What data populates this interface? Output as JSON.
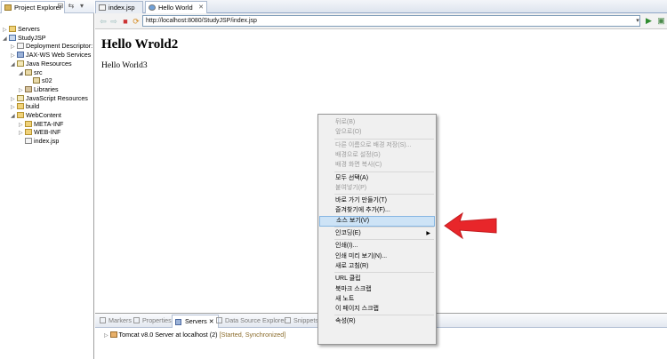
{
  "left_panel": {
    "tab_label": "Project Explorer",
    "tree": [
      {
        "label": "Servers",
        "level": 0,
        "icon": "folder-icon"
      },
      {
        "label": "StudyJSP",
        "level": 0,
        "icon": "project-icon"
      },
      {
        "label": "Deployment Descriptor:",
        "level": 1,
        "icon": "descriptor-icon"
      },
      {
        "label": "JAX-WS Web Services",
        "level": 1,
        "icon": "webservice-icon"
      },
      {
        "label": "Java Resources",
        "level": 1,
        "icon": "java-resources-icon"
      },
      {
        "label": "src",
        "level": 2,
        "icon": "source-folder-icon"
      },
      {
        "label": "s02",
        "level": 3,
        "icon": "package-icon"
      },
      {
        "label": "Libraries",
        "level": 2,
        "icon": "library-icon"
      },
      {
        "label": "JavaScript Resources",
        "level": 1,
        "icon": "javascript-resources-icon"
      },
      {
        "label": "build",
        "level": 1,
        "icon": "folder-icon"
      },
      {
        "label": "WebContent",
        "level": 1,
        "icon": "folder-icon"
      },
      {
        "label": "META-INF",
        "level": 2,
        "icon": "folder-icon"
      },
      {
        "label": "WEB-INF",
        "level": 2,
        "icon": "folder-icon"
      },
      {
        "label": "index.jsp",
        "level": 2,
        "icon": "jsp-file-icon"
      }
    ]
  },
  "editor": {
    "tabs": [
      {
        "label": "index.jsp",
        "active": false
      },
      {
        "label": "Hello World",
        "active": true
      }
    ],
    "url": "http://localhost:8080/StudyJSP/index.jsp",
    "page_heading": "Hello Wrold2",
    "page_text": "Hello World3"
  },
  "bottom_panel": {
    "tabs": [
      {
        "label": "Markers",
        "active": false
      },
      {
        "label": "Properties",
        "active": false
      },
      {
        "label": "Servers",
        "active": true
      },
      {
        "label": "Data Source Explorer",
        "active": false
      },
      {
        "label": "Snippets",
        "active": false
      }
    ],
    "server_name": "Tomcat v8.0 Server at localhost",
    "server_count": "(2)",
    "server_status": "[Started, Synchronized]"
  },
  "context_menu": {
    "items": [
      {
        "label": "뒤로(B)",
        "disabled": true
      },
      {
        "label": "앞으로(O)",
        "disabled": true
      },
      {
        "sep": true
      },
      {
        "label": "다른 이름으로 배경 저장(S)...",
        "disabled": true
      },
      {
        "label": "배경으로 설정(G)",
        "disabled": true
      },
      {
        "label": "배경 화면 복사(C)",
        "disabled": true
      },
      {
        "sep": true
      },
      {
        "label": "모두 선택(A)",
        "disabled": false
      },
      {
        "label": "붙여넣기(P)",
        "disabled": true
      },
      {
        "sep": true
      },
      {
        "label": "바로 가기 만들기(T)",
        "disabled": false
      },
      {
        "label": "즐겨찾기에 추가(F)...",
        "disabled": false
      },
      {
        "label": "소스 보기(V)",
        "disabled": false,
        "highlighted": true
      },
      {
        "sep": true
      },
      {
        "label": "인코딩(E)",
        "disabled": false,
        "submenu": true
      },
      {
        "sep": true
      },
      {
        "label": "인쇄(I)...",
        "disabled": false
      },
      {
        "label": "인쇄 미리 보기(N)...",
        "disabled": false
      },
      {
        "label": "새로 고침(R)",
        "disabled": false
      },
      {
        "sep": true
      },
      {
        "label": "URL 클립",
        "disabled": false
      },
      {
        "label": "북마크 스크랩",
        "disabled": false
      },
      {
        "label": "새 노트",
        "disabled": false
      },
      {
        "label": "이 페이지 스크랩",
        "disabled": false
      },
      {
        "sep": true
      },
      {
        "label": "속성(R)",
        "disabled": false
      }
    ]
  },
  "colors": {
    "accent_arrow": "#e8262a",
    "menu_highlight": "#cde3f6",
    "url_border": "#7f9db9"
  }
}
